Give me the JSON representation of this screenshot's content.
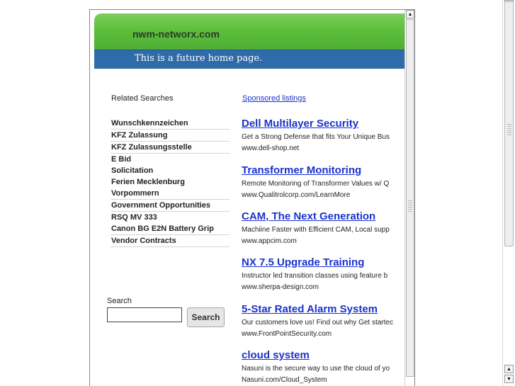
{
  "header": {
    "site_name": "nwm-networx.com",
    "tagline": "This is a future home page."
  },
  "related": {
    "heading": "Related Searches",
    "items": [
      {
        "label": "Wunschkennzeichen"
      },
      {
        "label": "KFZ Zulassung"
      },
      {
        "label": "KFZ Zulassungsstelle"
      },
      {
        "label": "E Bid"
      },
      {
        "label": "Solicitation"
      },
      {
        "label": "Ferien Mecklenburg"
      },
      {
        "label": "Vorpommern"
      },
      {
        "label": "Government Opportunities"
      },
      {
        "label": "RSQ MV 333"
      },
      {
        "label": "Canon BG E2N Battery Grip"
      },
      {
        "label": "Vendor Contracts"
      }
    ]
  },
  "search": {
    "label": "Search",
    "value": "",
    "button_label": "Search"
  },
  "sponsored": {
    "heading": "Sponsored listings",
    "ads": [
      {
        "title": "Dell Multilayer Security",
        "desc": "Get a Strong Defense that fits Your Unique Bus",
        "url": "www.dell-shop.net"
      },
      {
        "title": "Transformer Monitoring",
        "desc": "Remote Monitoring of Transformer Values w/ Q",
        "url": "www.Qualitrolcorp.com/LearnMore"
      },
      {
        "title": "CAM, The Next Generation",
        "desc": "Machiine Faster with Efficient CAM, Local supp",
        "url": "www.appcim.com"
      },
      {
        "title": "NX 7.5 Upgrade Training",
        "desc": "Instructor led transition classes using feature b",
        "url": "www.sherpa-design.com"
      },
      {
        "title": "5-Star Rated Alarm System",
        "desc": "Our customers love us! Find out why Get startec",
        "url": "www.FrontPointSecurity.com"
      },
      {
        "title": "cloud system",
        "desc": "Nasuni is the secure way to use the cloud of yo",
        "url": "Nasuni.com/Cloud_System"
      }
    ]
  },
  "colors": {
    "header_green": "#5cbf3c",
    "header_blue": "#2f6ba8",
    "link_blue": "#1a33cc"
  },
  "icons": {
    "scroll_up": "scroll-up-arrow-icon",
    "scroll_down": "scroll-down-arrow-icon"
  }
}
